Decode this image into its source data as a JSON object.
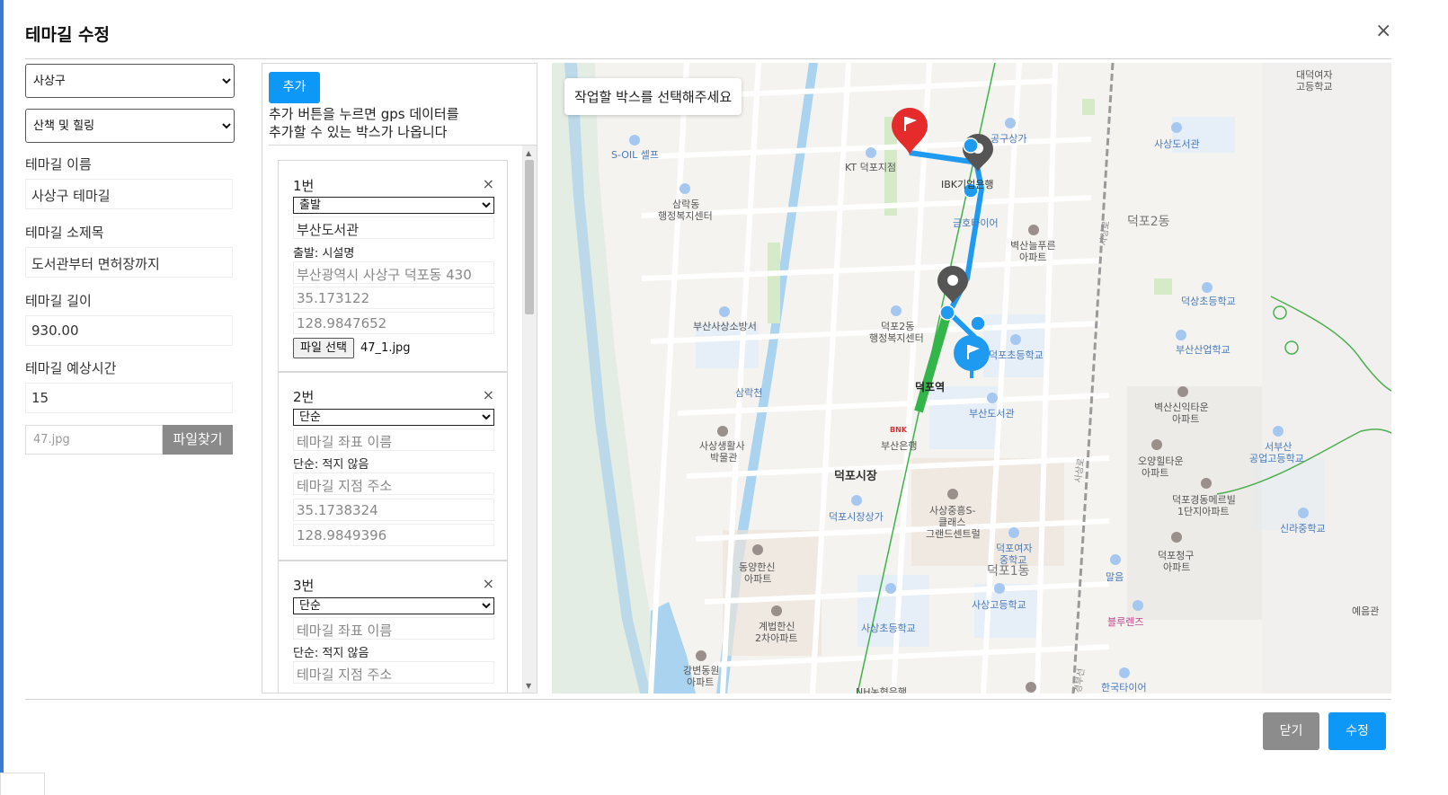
{
  "modal": {
    "title": "테마길 수정",
    "close_icon": "×"
  },
  "form": {
    "district_select": "사상구",
    "category_select": "산책 및 힐링",
    "name_label": "테마길 이름",
    "name_value": "사상구 테마길",
    "subtitle_label": "테마길 소제목",
    "subtitle_value": "도서관부터 면허장까지",
    "length_label": "테마길 길이",
    "length_value": "930.00",
    "time_label": "테마길 예상시간",
    "time_value": "15",
    "file_name": "47.jpg",
    "file_button": "파일찾기"
  },
  "points_panel": {
    "add_button": "추가",
    "guide_line1": "추가 버튼을 누르면 gps 데이터를",
    "guide_line2": "추가할 수 있는 박스가 나옵니다",
    "cards": [
      {
        "number": "1번",
        "type": "출발",
        "name": "부산도서관",
        "caption": "출발: 시설명",
        "address": "부산광역시 사상구 덕포동 430",
        "lat": "35.173122",
        "lng": "128.9847652",
        "file_button": "파일 선택",
        "file_name": "47_1.jpg"
      },
      {
        "number": "2번",
        "type": "단순",
        "name_placeholder": "테마길 좌표 이름",
        "caption": "단순: 적지 않음",
        "address_placeholder": "테마길 지점 주소",
        "lat": "35.1738324",
        "lng": "128.9849396"
      },
      {
        "number": "3번",
        "type": "단순",
        "name_placeholder": "테마길 좌표 이름",
        "caption": "단순: 적지 않음",
        "address_placeholder": "테마길 지점 주소"
      }
    ],
    "card_close_icon": "×"
  },
  "map": {
    "tooltip": "작업할 박스를 선택해주세요",
    "labels": {
      "soil": "S-OIL 셀프",
      "kt": "KT 덕포지점",
      "ibk": "IBK기업은행",
      "gonggu": "공구상가",
      "sarakdong1": "삼락동",
      "sarakdong2": "행정복지센터",
      "geumho": "금호타이어",
      "bulgeun1": "벽산늘푸른",
      "bulgeun2": "아파트",
      "deokpo2dong": "덕포2동",
      "daedeok1": "대덕여자",
      "daedeok2": "고등학교",
      "sasang_lib": "사상도서관",
      "deokpo_elem": "덕상초등학교",
      "busan_ind": "부산산업학교",
      "sasang_fire": "부산사상소방서",
      "deokpo2_admin1": "덕포2동",
      "deokpo2_admin2": "행정복지센터",
      "deokpo_school": "덕포초등학교",
      "samrakcheon": "삼락천",
      "deokpo_station": "덕포역",
      "busan_library": "부산도서관",
      "byeoksan1": "벽산신익타운",
      "byeoksan2": "아파트",
      "seobusan1": "서부산",
      "seobusan2": "공업고등학교",
      "museum1": "사상생활사",
      "museum2": "박물관",
      "busan_bank": "부산은행",
      "bnk": "BNK",
      "oyang1": "오양힐타운",
      "oyang2": "아파트",
      "market": "덕포시장",
      "sasang_jungheung1": "사상중흥S-",
      "sasang_jungheung2": "클래스",
      "sasang_jungheung3": "그랜드센트럴",
      "deokpo_merry1": "덕포경동메르빌",
      "deokpo_merry2": "1단지아파트",
      "silla": "신라중학교",
      "market_shop": "덕포시장상가",
      "girls_mid1": "덕포여자",
      "girls_mid2": "중학교",
      "deokpo1dong": "덕포1동",
      "dongyang1": "동양한신",
      "dongyang2": "아파트",
      "cheonggu1": "덕포청구",
      "cheonggu2": "아파트",
      "malgeum": "말음",
      "sasang_high": "사상고등학교",
      "gyebeop1": "계법한신",
      "gyebeop2": "2차아파트",
      "sasang_elem": "사상초등학교",
      "blue_lens": "블루렌즈",
      "yeseul": "예음관",
      "gangbyeon1": "강변동원",
      "gangbyeon2": "아파트",
      "nh": "NH농협은행",
      "hankook_tire": "한국타이어",
      "road1": "사상로",
      "road2": "사상로",
      "road3": "경부선"
    }
  },
  "footer": {
    "close_button": "닫기",
    "edit_button": "수정"
  }
}
